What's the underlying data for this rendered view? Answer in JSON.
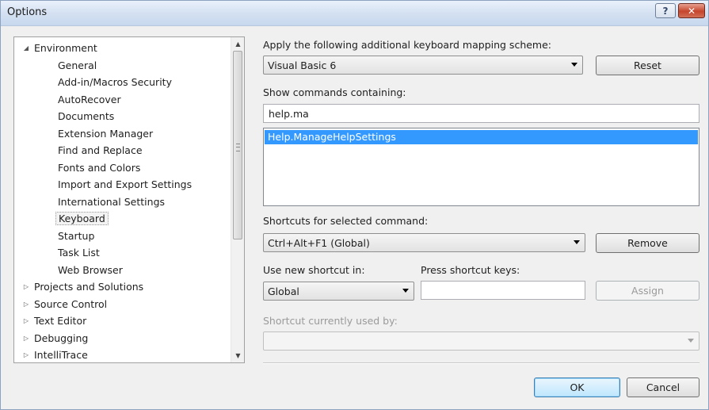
{
  "window": {
    "title": "Options",
    "help_label": "?",
    "close_label": "✕"
  },
  "tree": {
    "items": [
      {
        "label": "Environment",
        "expander": "◢",
        "level": 0,
        "selected": false
      },
      {
        "label": "General",
        "level": 1,
        "selected": false
      },
      {
        "label": "Add-in/Macros Security",
        "level": 1,
        "selected": false
      },
      {
        "label": "AutoRecover",
        "level": 1,
        "selected": false
      },
      {
        "label": "Documents",
        "level": 1,
        "selected": false
      },
      {
        "label": "Extension Manager",
        "level": 1,
        "selected": false
      },
      {
        "label": "Find and Replace",
        "level": 1,
        "selected": false
      },
      {
        "label": "Fonts and Colors",
        "level": 1,
        "selected": false
      },
      {
        "label": "Import and Export Settings",
        "level": 1,
        "selected": false
      },
      {
        "label": "International Settings",
        "level": 1,
        "selected": false
      },
      {
        "label": "Keyboard",
        "level": 1,
        "selected": true
      },
      {
        "label": "Startup",
        "level": 1,
        "selected": false
      },
      {
        "label": "Task List",
        "level": 1,
        "selected": false
      },
      {
        "label": "Web Browser",
        "level": 1,
        "selected": false
      },
      {
        "label": "Projects and Solutions",
        "expander": "▷",
        "level": 0,
        "selected": false
      },
      {
        "label": "Source Control",
        "expander": "▷",
        "level": 0,
        "selected": false
      },
      {
        "label": "Text Editor",
        "expander": "▷",
        "level": 0,
        "selected": false
      },
      {
        "label": "Debugging",
        "expander": "▷",
        "level": 0,
        "selected": false
      },
      {
        "label": "IntelliTrace",
        "expander": "▷",
        "level": 0,
        "selected": false
      }
    ]
  },
  "mapping": {
    "label": "Apply the following additional keyboard mapping scheme:",
    "value": "Visual Basic 6",
    "reset_label": "Reset"
  },
  "commands": {
    "label": "Show commands containing:",
    "filter_value": "help.ma",
    "items": [
      "Help.ManageHelpSettings"
    ]
  },
  "shortcuts": {
    "label": "Shortcuts for selected command:",
    "value": "Ctrl+Alt+F1 (Global)",
    "remove_label": "Remove"
  },
  "new_shortcut": {
    "use_in_label": "Use new shortcut in:",
    "use_in_value": "Global",
    "press_label": "Press shortcut keys:",
    "press_value": "",
    "assign_label": "Assign"
  },
  "used_by": {
    "label": "Shortcut currently used by:",
    "value": ""
  },
  "footer": {
    "ok_label": "OK",
    "cancel_label": "Cancel"
  }
}
